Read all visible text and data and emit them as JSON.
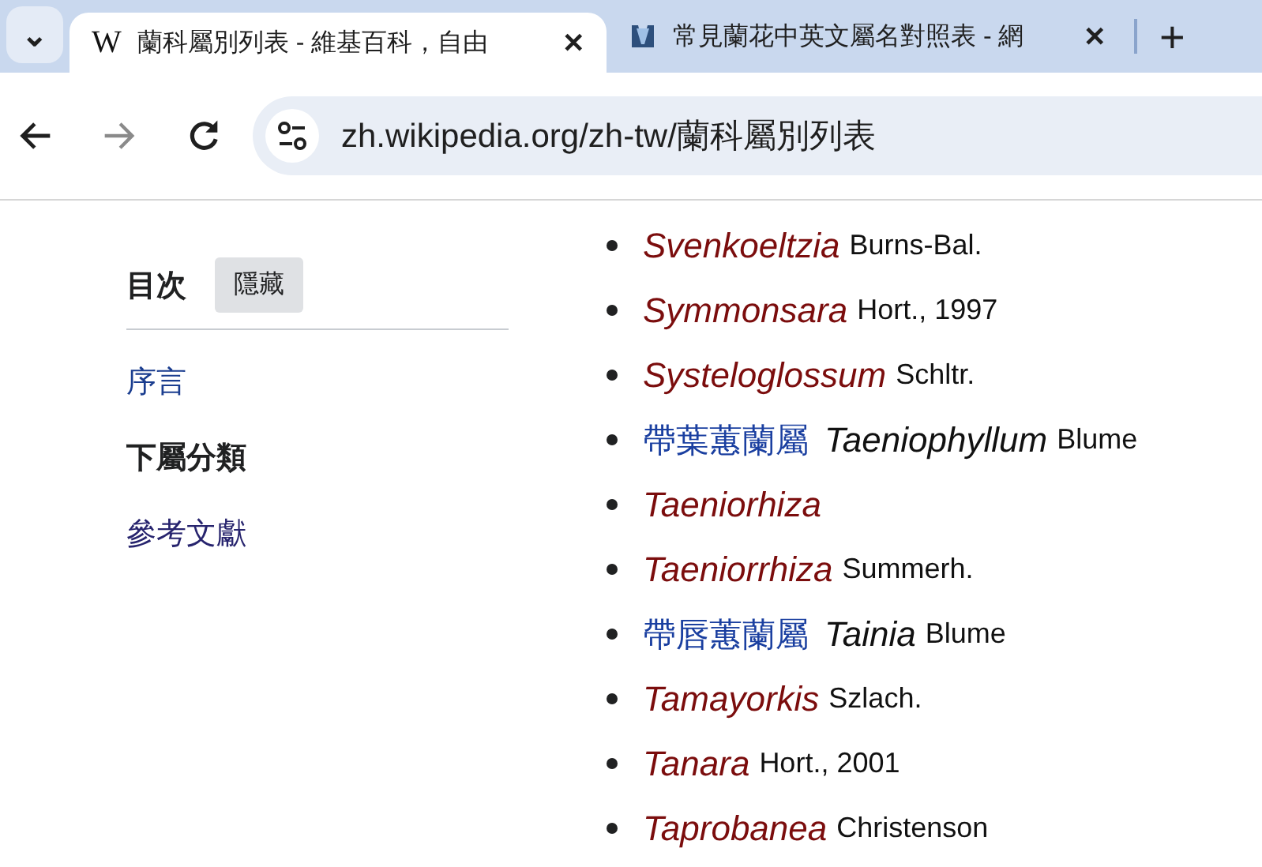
{
  "tabs": [
    {
      "title": "蘭科屬別列表 - 維基百科，自由",
      "selected": true,
      "close": "✕",
      "icon": "W"
    },
    {
      "title": "常見蘭花中英文屬名對照表 - 網",
      "selected": false,
      "close": "✕"
    }
  ],
  "tab_strip": {
    "menu": "⌄",
    "new_tab": "+"
  },
  "address_bar": {
    "url": "zh.wikipedia.org/zh-tw/蘭科屬別列表"
  },
  "toc": {
    "title": "目次",
    "hide_button": "隱藏",
    "items": [
      {
        "label": "序言",
        "selected": false
      },
      {
        "label": "下屬分類",
        "selected": true
      },
      {
        "label": "參考文獻",
        "selected": false
      }
    ]
  },
  "genera": [
    {
      "kind": "redlink",
      "genus": "Svenkoeltzia",
      "author": "Burns-Bal."
    },
    {
      "kind": "redlink",
      "genus": "Symmonsara",
      "author": "Hort., 1997"
    },
    {
      "kind": "redlink",
      "genus": "Systeloglossum",
      "author": "Schltr."
    },
    {
      "kind": "bluelink",
      "chinese": "帶葉蕙蘭屬",
      "genus": "Taeniophyllum",
      "author": "Blume"
    },
    {
      "kind": "redlink",
      "genus": "Taeniorhiza"
    },
    {
      "kind": "redlink",
      "genus": "Taeniorrhiza",
      "author": "Summerh."
    },
    {
      "kind": "bluelink",
      "chinese": "帶唇蕙蘭屬",
      "genus": "Tainia",
      "author": "Blume"
    },
    {
      "kind": "redlink",
      "genus": "Tamayorkis",
      "author": "Szlach."
    },
    {
      "kind": "redlink",
      "genus": "Tanara",
      "author": "Hort., 2001"
    },
    {
      "kind": "redlink",
      "genus": "Taprobanea",
      "author": "Christenson"
    }
  ]
}
